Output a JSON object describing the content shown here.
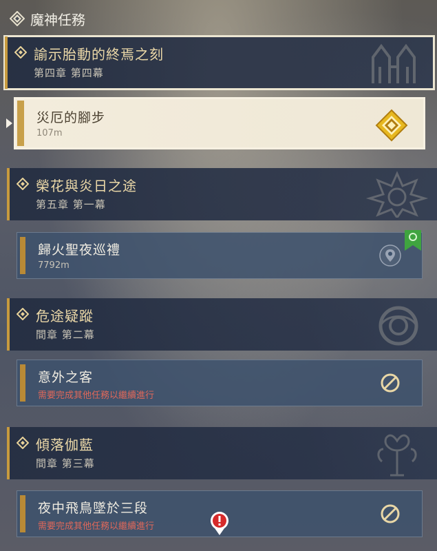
{
  "header": {
    "title": "魔神任務",
    "icon": "archon-quest-icon"
  },
  "chapters": [
    {
      "title": "諭示胎動的終焉之刻",
      "subtitle": "第四章 第四幕",
      "selected": true,
      "quest": {
        "title": "災厄的腳步",
        "detail": "107m",
        "icon": "tracked-quest-diamond-icon",
        "active": true
      }
    },
    {
      "title": "榮花與炎日之途",
      "subtitle": "第五章 第一幕",
      "quest": {
        "title": "歸火聖夜巡禮",
        "detail": "7792m",
        "icon": "location-pin-icon",
        "bookmark": "green-new-bookmark-icon"
      }
    },
    {
      "title": "危途疑蹤",
      "subtitle": "間章 第二幕",
      "quest": {
        "title": "意外之客",
        "detail": "需要完成其他任務以繼續進行",
        "icon": "blocked-icon"
      }
    },
    {
      "title": "傾落伽藍",
      "subtitle": "間章 第三幕",
      "quest": {
        "title": "夜中飛鳥墜於三段",
        "detail": "需要完成其他任務以繼續進行",
        "icon": "blocked-icon"
      }
    }
  ],
  "colors": {
    "accent_gold": "#c79a3e",
    "warning_red": "#e0685a",
    "panel_navy": "#232d41"
  }
}
